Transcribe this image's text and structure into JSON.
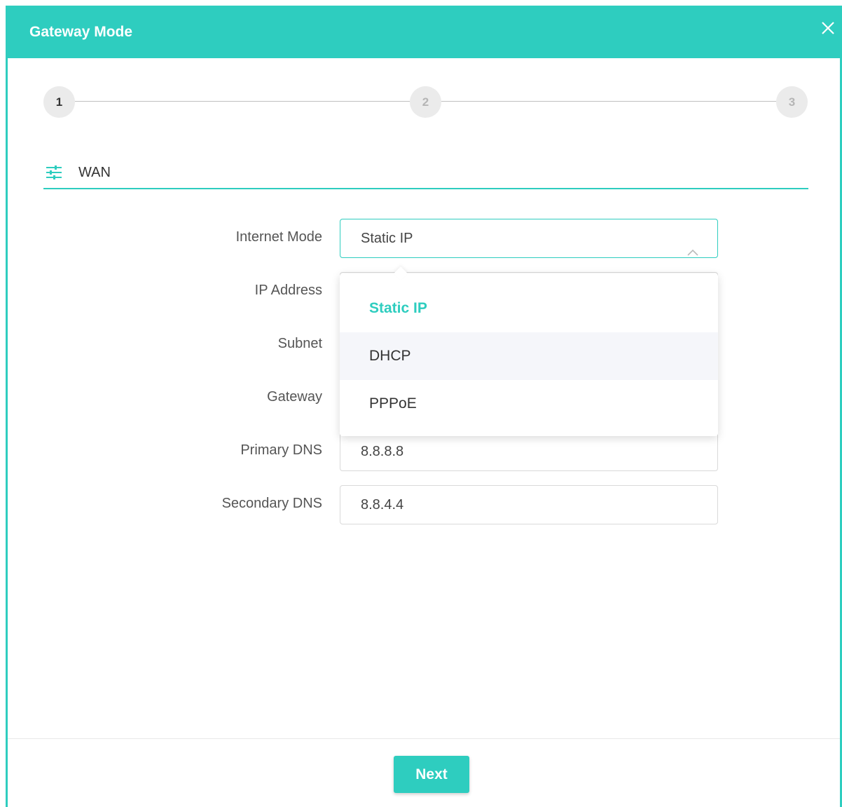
{
  "dialog": {
    "title": "Gateway Mode",
    "accent_color": "#2ecdbf"
  },
  "stepper": {
    "steps": [
      "1",
      "2",
      "3"
    ],
    "current": "1"
  },
  "section": {
    "icon": "sliders-icon",
    "title": "WAN"
  },
  "form": {
    "internet_mode": {
      "label": "Internet Mode",
      "value": "Static IP"
    },
    "ip_address": {
      "label": "IP Address"
    },
    "subnet": {
      "label": "Subnet"
    },
    "gateway": {
      "label": "Gateway"
    },
    "primary_dns": {
      "label": "Primary DNS",
      "value": "8.8.8.8"
    },
    "secondary_dns": {
      "label": "Secondary DNS",
      "value": "8.8.4.4"
    }
  },
  "dropdown": {
    "options": [
      "Static IP",
      "DHCP",
      "PPPoE"
    ],
    "selected": "Static IP",
    "hovered": "DHCP"
  },
  "footer": {
    "next_label": "Next"
  }
}
